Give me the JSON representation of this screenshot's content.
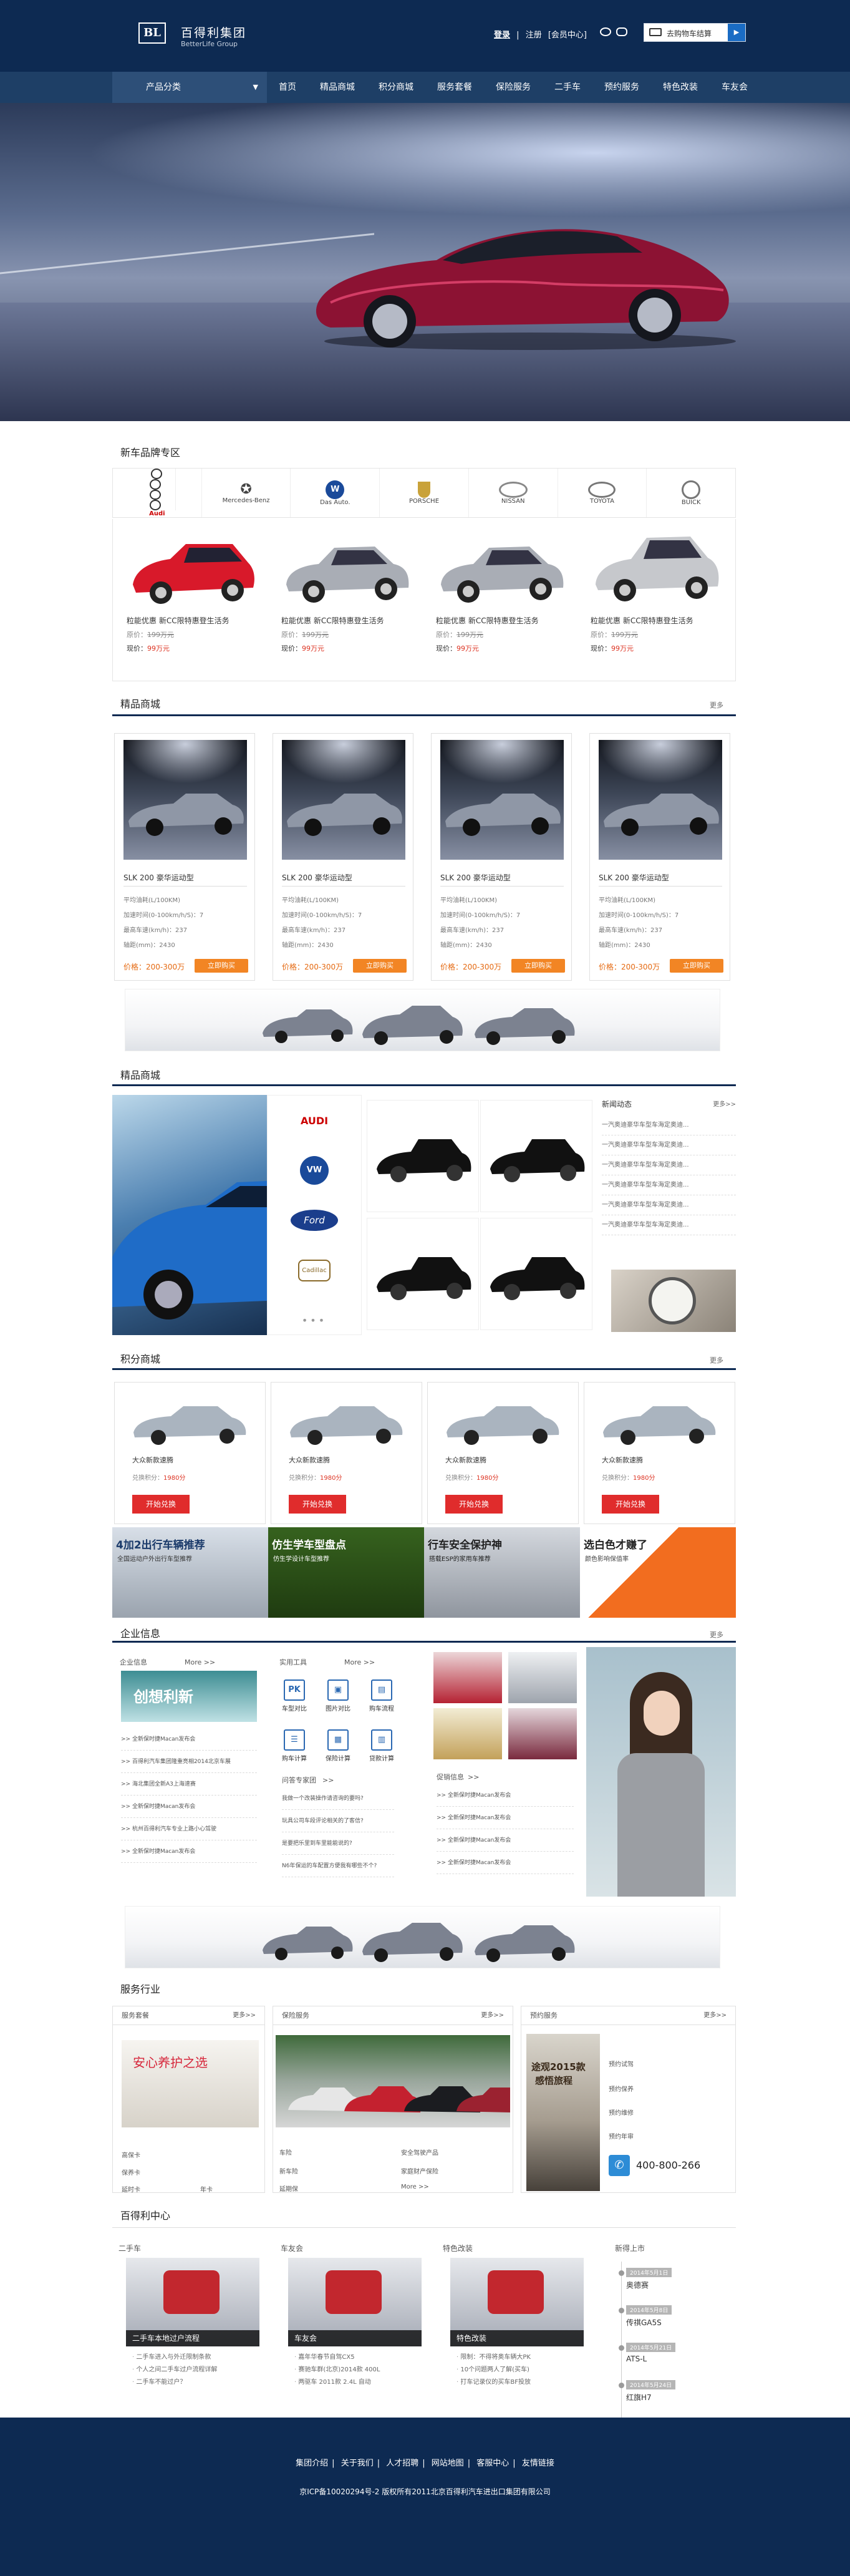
{
  "header": {
    "logo_text": "BL",
    "brand_cn": "百得利集团",
    "brand_en": "BetterLife Group",
    "login": "登录",
    "sep": "|",
    "register": "注册",
    "member": "[会员中心]",
    "cart": "去购物车结算",
    "cart_arrow": "▶"
  },
  "nav": {
    "category": "产品分类",
    "items": [
      "首页",
      "精品商城",
      "积分商城",
      "服务套餐",
      "保险服务",
      "二手车",
      "预约服务",
      "特色改装",
      "车友会"
    ]
  },
  "brand_zone": {
    "title": "新车品牌专区",
    "brands": [
      "Audi",
      "Mercedes-Benz",
      "Das Auto.",
      "PORSCHE",
      "NISSAN",
      "TOYOTA",
      "BUICK"
    ],
    "cars": [
      {
        "title": "粒能优惠 新CC限特惠登生活务",
        "orig_label": "原价：",
        "orig": "199万元",
        "now_label": "现价：",
        "now": "99万元",
        "color": "#d8192a"
      },
      {
        "title": "粒能优惠 新CC限特惠登生活务",
        "orig_label": "原价：",
        "orig": "199万元",
        "now_label": "现价：",
        "now": "99万元",
        "color": "#a9adb5"
      },
      {
        "title": "粒能优惠 新CC限特惠登生活务",
        "orig_label": "原价：",
        "orig": "199万元",
        "now_label": "现价：",
        "now": "99万元",
        "color": "#a9adb5"
      },
      {
        "title": "粒能优惠 新CC限特惠登生活务",
        "orig_label": "原价：",
        "orig": "199万元",
        "now_label": "现价：",
        "now": "99万元",
        "color": "#c6c8cc"
      }
    ]
  },
  "mall": {
    "title": "精品商城",
    "more": "更多",
    "products": [
      {
        "name": "SLK 200 豪华运动型",
        "specs": [
          "平均油耗(L/100KM)",
          "加速时间(0-100km/h/S)：7",
          "最高车速(km/h)：237",
          "轴距(mm)：2430"
        ],
        "price": "价格：200-300万",
        "buy": "立即购买"
      },
      {
        "name": "SLK 200 豪华运动型",
        "specs": [
          "平均油耗(L/100KM)",
          "加速时间(0-100km/h/S)：7",
          "最高车速(km/h)：237",
          "轴距(mm)：2430"
        ],
        "price": "价格：200-300万",
        "buy": "立即购买"
      },
      {
        "name": "SLK 200 豪华运动型",
        "specs": [
          "平均油耗(L/100KM)",
          "加速时间(0-100km/h/S)：7",
          "最高车速(km/h)：237",
          "轴距(mm)：2430"
        ],
        "price": "价格：200-300万",
        "buy": "立即购买"
      },
      {
        "name": "SLK 200 豪华运动型",
        "specs": [
          "平均油耗(L/100KM)",
          "加速时间(0-100km/h/S)：7",
          "最高车速(km/h)：237",
          "轴距(mm)：2430"
        ],
        "price": "价格：200-300万",
        "buy": "立即购买"
      }
    ]
  },
  "mall2": {
    "title": "精品商城",
    "logos": [
      "AUDI",
      "VW",
      "Ford",
      "Cadillac"
    ],
    "news_title": "新闻动态",
    "news_more": "更多>>",
    "news": [
      "一汽奥迪豪华车型车海定奥迪...",
      "一汽奥迪豪华车型车海定奥迪...",
      "一汽奥迪豪华车型车海定奥迪...",
      "一汽奥迪豪华车型车海定奥迪...",
      "一汽奥迪豪华车型车海定奥迪...",
      "一汽奥迪豪华车型车海定奥迪..."
    ]
  },
  "points": {
    "title": "积分商城",
    "more": "更多",
    "items": [
      {
        "name": "大众新款速腾",
        "score_label": "兑换积分：",
        "score": "1980分",
        "btn": "开始兑换"
      },
      {
        "name": "大众新款速腾",
        "score_label": "兑换积分：",
        "score": "1980分",
        "btn": "开始兑换"
      },
      {
        "name": "大众新款速腾",
        "score_label": "兑换积分：",
        "score": "1980分",
        "btn": "开始兑换"
      },
      {
        "name": "大众新款速腾",
        "score_label": "兑换积分：",
        "score": "1980分",
        "btn": "开始兑换"
      }
    ],
    "ads": [
      {
        "title": "4加2出行车辆推荐",
        "sub": "全国运动户外出行车型推荐"
      },
      {
        "title": "仿生学车型盘点",
        "sub": "仿生学设计车型推荐"
      },
      {
        "title": "行车安全保护神",
        "sub": "搭载ESP的家用车推荐"
      },
      {
        "title": "选白色才赚了",
        "sub": "颜色影响保值率"
      }
    ]
  },
  "enterprise": {
    "title": "企业信息",
    "more": "更多",
    "info_title": "企业信息",
    "info_more": "More >>",
    "info_banner": "创想利新",
    "info_list": [
      ">> 全新保时捷Macan发布会",
      ">> 百得利汽车集团隆重亮相2014北京车展",
      ">> 海北集团全新A3上海速赛",
      ">> 全新保时捷Macan发布会",
      ">> 杭州百得利汽车专业上路小心驾驶",
      ">> 全新保时捷Macan发布会"
    ],
    "tools_title": "实用工具",
    "tools_more": "More >>",
    "tools": [
      {
        "icon": "PK",
        "label": "车型对比"
      },
      {
        "icon": "▣",
        "label": "图片对比"
      },
      {
        "icon": "▤",
        "label": "购车流程"
      },
      {
        "icon": "☰",
        "label": "购车计算"
      },
      {
        "icon": "▦",
        "label": "保险计算"
      },
      {
        "icon": "▥",
        "label": "贷款计算"
      }
    ],
    "faq_title": "问答专家团",
    "faq_more": ">>",
    "faq": [
      "我做一个改装操作请咨询的要吗?",
      "玩具公司车段评论相关的了客信?",
      "是要把乐里到车里能能说的?",
      "N6年保运的车配置方便我有哪些不个?"
    ],
    "promo_title": "促销信息",
    "promo_more": ">>",
    "promo": [
      ">> 全新保时捷Macan发布会",
      ">> 全新保时捷Macan发布会",
      ">> 全新保时捷Macan发布会",
      ">> 全新保时捷Macan发布会"
    ]
  },
  "service": {
    "title": "服务行业",
    "blocks": [
      {
        "name": "服务套餐",
        "more": "更多>>"
      },
      {
        "name": "保险服务",
        "more": "更多>>"
      },
      {
        "name": "预约服务",
        "more": "更多>>"
      }
    ],
    "care_text": "安心养护之选",
    "care_links": [
      "高保卡",
      "保养卡",
      "延时卡",
      "年卡"
    ],
    "ins_links": [
      "车险",
      "安全驾驶产品",
      "新车险",
      "家庭财产保险",
      "延期保",
      "More >>"
    ],
    "appt_links": [
      "预约试驾",
      "预约保养",
      "预约维修",
      "预约年审"
    ],
    "tour_title": "途观2015款",
    "tour_sub": "感悟旅程",
    "phone": "400-800-266"
  },
  "center": {
    "title": "百得利中心",
    "cols": [
      {
        "name": "二手车",
        "cap": "二手车本地过户流程",
        "items": [
          "二手车进入与外迁限制条款",
          "个人之间二手车过户流程详解",
          "二手车不能过户？"
        ]
      },
      {
        "name": "车友会",
        "cap": "车友会",
        "items": [
          "嘉年华春节自驾CX5",
          "赛驰车群(北京)2014款 400L",
          "两驱车 2011款 2.4L 自动"
        ]
      },
      {
        "name": "特色改装",
        "cap": "特色改装",
        "items": [
          "限制：不得将奥车辆大PK",
          "10个问题两人了解(买车)",
          "打车记录仪的买车BF投放"
        ]
      }
    ],
    "tl_title": "新得上市",
    "timeline": [
      {
        "date": "2014年5月1日",
        "name": "奥德赛"
      },
      {
        "date": "2014年5月8日",
        "name": "传祺GA5S"
      },
      {
        "date": "2014年5月21日",
        "name": "ATS-L"
      },
      {
        "date": "2014年5月24日",
        "name": "红旗H7"
      }
    ]
  },
  "footer": {
    "links": [
      "集团介绍",
      "关于我们",
      "人才招聘",
      "网站地图",
      "客服中心",
      "友情链接"
    ],
    "icp": "京ICP备10020294号-2 版权所有2011北京百得利汽车进出口集团有限公司"
  }
}
